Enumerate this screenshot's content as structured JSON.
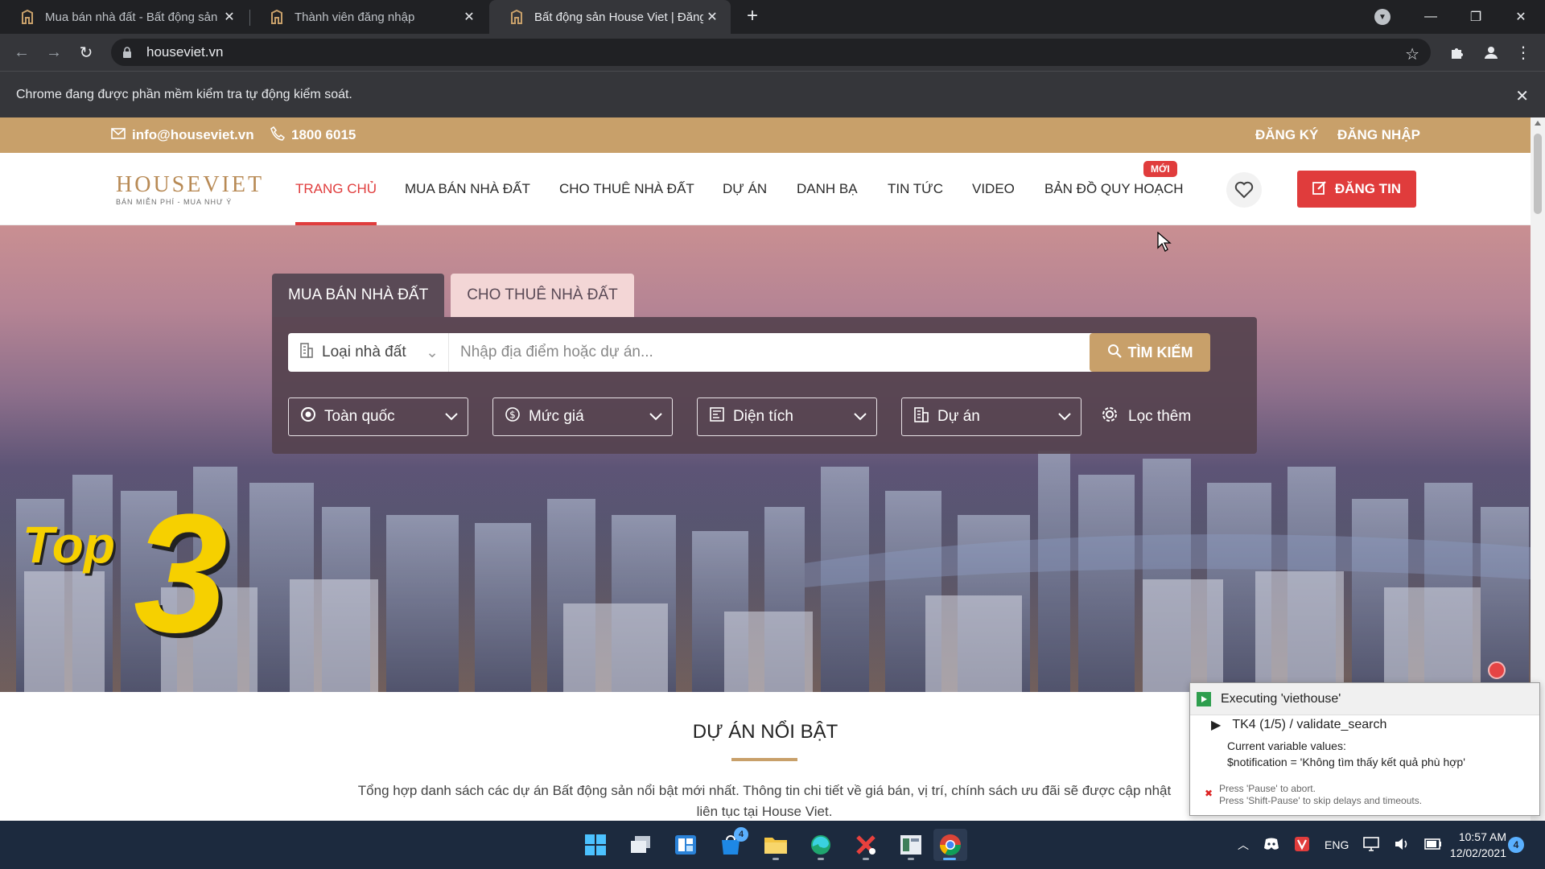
{
  "browser": {
    "tabs": [
      {
        "title": "Mua bán nhà đất - Bất động sản"
      },
      {
        "title": "Thành viên đăng nhập"
      },
      {
        "title": "Bất động sản House Viet | Đăng t"
      }
    ],
    "address": "houseviet.vn",
    "automation_notice": "Chrome đang được phần mềm kiểm tra tự động kiểm soát."
  },
  "site": {
    "topbar": {
      "email": "info@houseviet.vn",
      "phone": "1800 6015",
      "register": "ĐĂNG KÝ",
      "login": "ĐĂNG NHẬP"
    },
    "logo": {
      "brand": "HOUSEVIET",
      "slogan": "BÁN MIỄN PHÍ - MUA NHƯ Ý"
    },
    "nav": [
      {
        "label": "TRANG CHỦ"
      },
      {
        "label": "MUA BÁN NHÀ ĐẤT"
      },
      {
        "label": "CHO THUÊ NHÀ ĐẤT"
      },
      {
        "label": "DỰ ÁN"
      },
      {
        "label": "DANH BẠ"
      },
      {
        "label": "TIN TỨC"
      },
      {
        "label": "VIDEO"
      },
      {
        "label": "BẢN ĐỒ QUY HOẠCH"
      }
    ],
    "nav_new_badge": "MỚI",
    "post_button": "ĐĂNG TIN",
    "search": {
      "tabs": [
        {
          "label": "MUA BÁN NHÀ ĐẤT"
        },
        {
          "label": "CHO THUÊ NHÀ ĐẤT"
        }
      ],
      "type_label": "Loại nhà đất",
      "placeholder": "Nhập địa điểm hoặc dự án...",
      "button": "TÌM KIẾM",
      "filters": [
        {
          "label": "Toàn quốc",
          "icon": "location-icon"
        },
        {
          "label": "Mức giá",
          "icon": "dollar-icon"
        },
        {
          "label": "Diện tích",
          "icon": "area-icon"
        },
        {
          "label": "Dự án",
          "icon": "building-icon"
        }
      ],
      "more_filters": "Lọc thêm"
    },
    "banner": {
      "top": "Top",
      "number": "3"
    },
    "featured": {
      "title": "DỰ ÁN NỔI BẬT",
      "description": "Tổng hợp danh sách các dự án Bất động sản nổi bật mới nhất. Thông tin chi tiết về giá bán, vị trí, chính sách ưu đãi sẽ được cập nhật liên tục tại House Viet."
    }
  },
  "katalon": {
    "status": "Executing 'viethouse'",
    "step": "TK4 (1/5) / validate_search",
    "vars_label": "Current variable values:",
    "var_line": "$notification = 'Không tìm thấy kết quả phù hợp'",
    "hint1": "Press 'Pause' to abort.",
    "hint2": "Press 'Shift-Pause' to skip delays and timeouts."
  },
  "taskbar": {
    "lang": "ENG",
    "time": "10:57 AM",
    "date": "12/02/2021",
    "notifications": "4",
    "store_badge": "4"
  },
  "colors": {
    "accent_gold": "#c8a06a",
    "accent_red": "#e03c3c"
  }
}
